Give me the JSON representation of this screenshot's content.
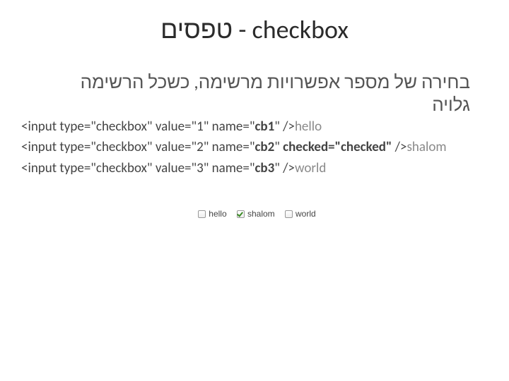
{
  "title": "טפסים - checkbox",
  "subtitle": "בחירה של מספר אפשרויות מרשימה, כשכל הרשימה גלויה",
  "code": {
    "line1_a": "<input type=\"checkbox\" value=\"1\" name=\"",
    "line1_b": "cb1",
    "line1_c": "\" />",
    "line1_after": "hello",
    "line2_a": "<input type=\"checkbox\" value=\"2\" name=\"",
    "line2_b": "cb2",
    "line2_c": "\" ",
    "line2_checked": "checked=\"checked\"",
    "line2_d": " />",
    "line2_after": "shalom",
    "line3_a": "<input type=\"checkbox\" value=\"3\" name=\"",
    "line3_b": "cb3",
    "line3_c": "\" />",
    "line3_after": "world"
  },
  "demo": {
    "items": [
      {
        "label": "hello",
        "checked": false
      },
      {
        "label": "shalom",
        "checked": true
      },
      {
        "label": "world",
        "checked": false
      }
    ]
  }
}
